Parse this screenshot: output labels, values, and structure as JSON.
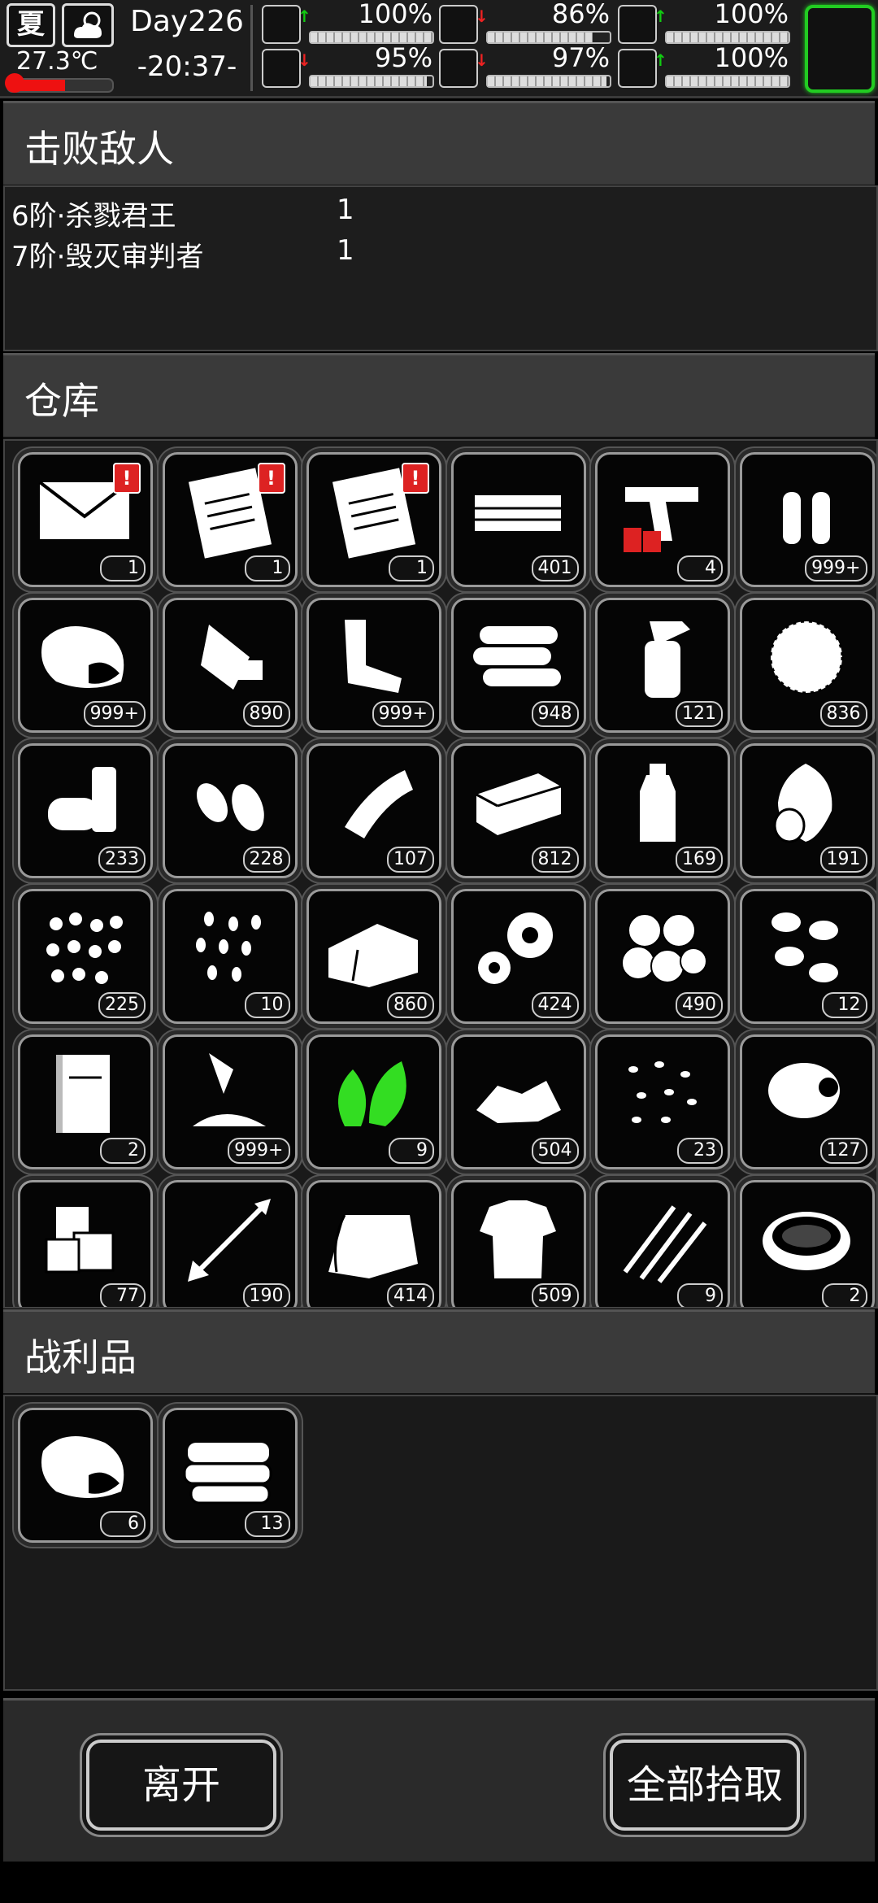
{
  "status": {
    "season": "夏",
    "temperature": "27.3℃",
    "temperature_level": 0.55,
    "day": "Day226",
    "time": "-20:37-",
    "stats": [
      {
        "name": "health-icon",
        "arrow": "up",
        "value": "100%",
        "level": 1.0
      },
      {
        "name": "stomach-icon",
        "arrow": "down",
        "value": "86%",
        "level": 0.86
      },
      {
        "name": "pill-icon",
        "arrow": "up",
        "value": "100%",
        "level": 1.0
      },
      {
        "name": "foot-icon",
        "arrow": "down",
        "value": "95%",
        "level": 0.95
      },
      {
        "name": "water-drop-icon",
        "arrow": "down",
        "value": "97%",
        "level": 0.97
      },
      {
        "name": "heart-icon",
        "arrow": "up",
        "value": "100%",
        "level": 1.0
      }
    ]
  },
  "enemies": {
    "title": "击败敌人",
    "rows": [
      {
        "name": "6阶·杀戮君王",
        "count": "1"
      },
      {
        "name": "7阶·毁灭审判者",
        "count": "1"
      }
    ]
  },
  "warehouse": {
    "title": "仓库",
    "items": [
      {
        "icon": "envelope-icon",
        "count": "1",
        "alert": "!"
      },
      {
        "icon": "clipboard-icon",
        "count": "1",
        "alert": "!"
      },
      {
        "icon": "clipboard-icon",
        "count": "1",
        "alert": "!"
      },
      {
        "icon": "money-stack-icon",
        "count": "401"
      },
      {
        "icon": "flare-gun-icon",
        "count": "4"
      },
      {
        "icon": "bullets-icon",
        "count": "999+"
      },
      {
        "icon": "meat-icon",
        "count": "999+"
      },
      {
        "icon": "scrap-bottle-icon",
        "count": "890"
      },
      {
        "icon": "pipe-scrap-icon",
        "count": "999+"
      },
      {
        "icon": "logs-icon",
        "count": "948"
      },
      {
        "icon": "spray-bottle-icon",
        "count": "121"
      },
      {
        "icon": "fiber-icon",
        "count": "836"
      },
      {
        "icon": "canned-food-icon",
        "count": "233"
      },
      {
        "icon": "earplugs-icon",
        "count": "228"
      },
      {
        "icon": "bandage-icon",
        "count": "107"
      },
      {
        "icon": "brick-icon",
        "count": "812"
      },
      {
        "icon": "water-bottle-icon",
        "count": "169"
      },
      {
        "icon": "vegetables-icon",
        "count": "191"
      },
      {
        "icon": "berries-icon",
        "count": "225"
      },
      {
        "icon": "seeds-icon",
        "count": "10"
      },
      {
        "icon": "cloth-icon",
        "count": "860"
      },
      {
        "icon": "gears-icon",
        "count": "424"
      },
      {
        "icon": "cotton-balls-icon",
        "count": "490"
      },
      {
        "icon": "beans-icon",
        "count": "12"
      },
      {
        "icon": "book-icon",
        "count": "2"
      },
      {
        "icon": "flour-icon",
        "count": "999+"
      },
      {
        "icon": "herb-icon",
        "count": "9"
      },
      {
        "icon": "stone-rubble-icon",
        "count": "504"
      },
      {
        "icon": "rice-grains-icon",
        "count": "23"
      },
      {
        "icon": "egg-icon",
        "count": "127"
      },
      {
        "icon": "ice-cubes-icon",
        "count": "77"
      },
      {
        "icon": "arrow-icon",
        "count": "190"
      },
      {
        "icon": "towel-icon",
        "count": "414"
      },
      {
        "icon": "rag-shirt-icon",
        "count": "509"
      },
      {
        "icon": "claw-marks-icon",
        "count": "9"
      },
      {
        "icon": "soup-bowl-icon",
        "count": "2"
      }
    ]
  },
  "loot": {
    "title": "战利品",
    "items": [
      {
        "icon": "meat-icon",
        "count": "6"
      },
      {
        "icon": "cloth-pile-icon",
        "count": "13"
      }
    ]
  },
  "buttons": {
    "leave": "离开",
    "take_all": "全部拾取"
  },
  "colors": {
    "alert": "#dd2222",
    "herb_green": "#33dd22",
    "accent_green": "#22cc22",
    "arrow_up": "#11cc11",
    "arrow_down": "#ee2222"
  }
}
